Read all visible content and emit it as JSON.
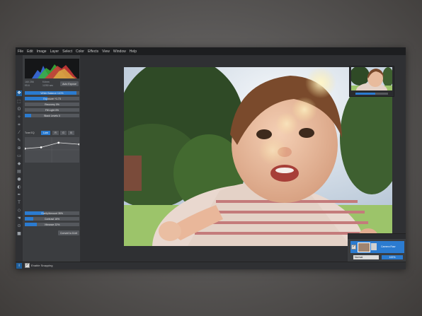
{
  "menu": [
    "File",
    "Edit",
    "Image",
    "Layer",
    "Select",
    "Color",
    "Effects",
    "View",
    "Window",
    "Help"
  ],
  "histogram_readout": {
    "line1_left": "160 256",
    "line1_right": "f/4mm",
    "line2_left": "f/5.6",
    "line2_right": "1/250 sec"
  },
  "auto_expose_label": "Auto Expose",
  "adjustments": [
    {
      "label": "White Balance 110%",
      "value": 0.95
    },
    {
      "label": "Exposure +1.73",
      "value": 0.42
    },
    {
      "label": "Recovery 0%",
      "value": 0.0
    },
    {
      "label": "Fill Light 0%",
      "value": 0.0
    },
    {
      "label": "Black Levels 0",
      "value": 0.12
    }
  ],
  "tone_curve": {
    "title": "Tone EQ",
    "buttons": [
      "Lum",
      "R",
      "G",
      "B"
    ],
    "selected": "Lum",
    "points": [
      [
        0,
        0.55
      ],
      [
        0.3,
        0.6
      ],
      [
        0.62,
        0.78
      ],
      [
        1,
        0.72
      ]
    ]
  },
  "adjustments2": [
    {
      "label": "Clarity/Amount 35%",
      "value": 0.35
    },
    {
      "label": "Contrast 16%",
      "value": 0.16
    },
    {
      "label": "Vibrance 22%",
      "value": 0.22
    }
  ],
  "convert_label": "Convert to 8-bit",
  "layers": {
    "layer_name": "Camera Raw",
    "blend_mode": "Normal",
    "opacity": "100%"
  },
  "status": {
    "snapping_label": "Enable Snapping",
    "snapping_checked": true
  },
  "colors": {
    "accent": "#2b7bd0",
    "panel": "#3b3d40",
    "menubar": "#1d1e20"
  }
}
